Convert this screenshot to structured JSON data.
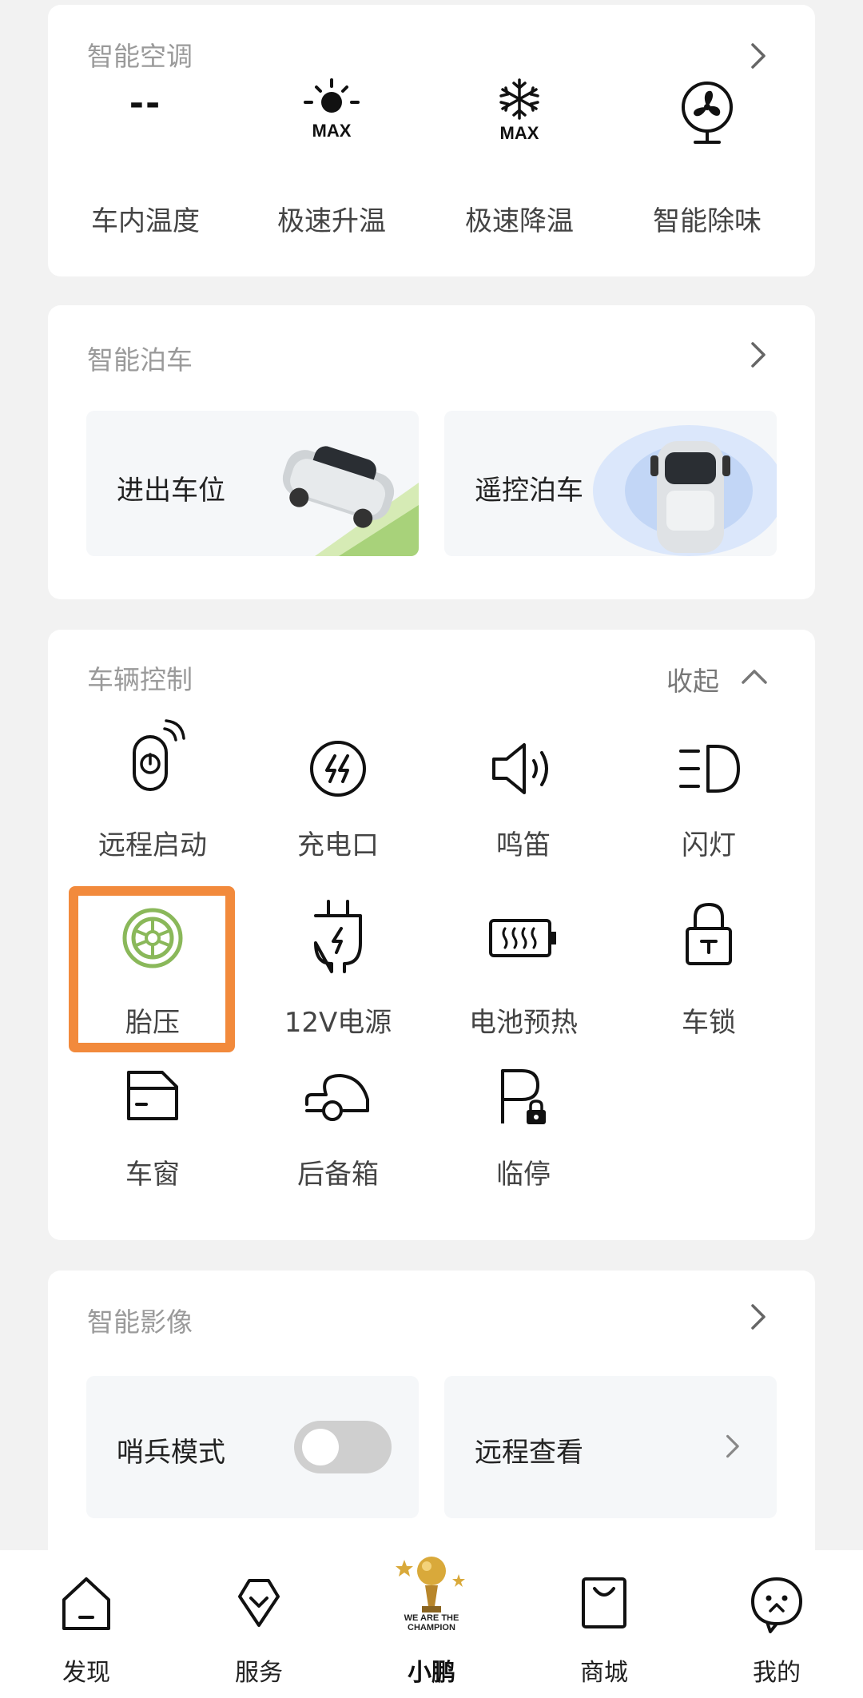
{
  "ac": {
    "title": "智能空调",
    "temp_value": "--",
    "items": [
      {
        "label": "车内温度",
        "icon": "temperature-value"
      },
      {
        "label": "极速升温",
        "icon": "sun-max-icon"
      },
      {
        "label": "极速降温",
        "icon": "snowflake-max-icon"
      },
      {
        "label": "智能除味",
        "icon": "fan-icon"
      }
    ],
    "max_text": "MAX"
  },
  "parking": {
    "title": "智能泊车",
    "tiles": [
      {
        "label": "进出车位",
        "icon": "car-parking-image"
      },
      {
        "label": "遥控泊车",
        "icon": "car-remote-image"
      }
    ]
  },
  "vehicle": {
    "title": "车辆控制",
    "collapse_label": "收起",
    "items": [
      {
        "label": "远程启动",
        "icon": "remote-start-icon"
      },
      {
        "label": "充电口",
        "icon": "charge-port-icon"
      },
      {
        "label": "鸣笛",
        "icon": "horn-icon"
      },
      {
        "label": "闪灯",
        "icon": "headlight-icon"
      },
      {
        "label": "胎压",
        "icon": "tire-icon"
      },
      {
        "label": "12V电源",
        "icon": "plug-icon"
      },
      {
        "label": "电池预热",
        "icon": "battery-heat-icon"
      },
      {
        "label": "车锁",
        "icon": "lock-icon"
      },
      {
        "label": "车窗",
        "icon": "window-icon"
      },
      {
        "label": "后备箱",
        "icon": "trunk-icon"
      },
      {
        "label": "临停",
        "icon": "parking-lock-icon"
      }
    ]
  },
  "video": {
    "title": "智能影像",
    "sentry_label": "哨兵模式",
    "sentry_on": false,
    "remote_label": "远程查看"
  },
  "tabs": [
    {
      "label": "发现",
      "icon": "home-icon"
    },
    {
      "label": "服务",
      "icon": "service-icon"
    },
    {
      "label": "小鹏",
      "icon": "champion-logo-icon"
    },
    {
      "label": "商城",
      "icon": "shop-bag-icon"
    },
    {
      "label": "我的",
      "icon": "profile-chat-icon"
    }
  ],
  "champion_text": "WE ARE THE CHAMPION",
  "colors": {
    "accent_orange": "#f28a3c",
    "tire_green": "#8ab85a",
    "gold": "#c8962e"
  }
}
